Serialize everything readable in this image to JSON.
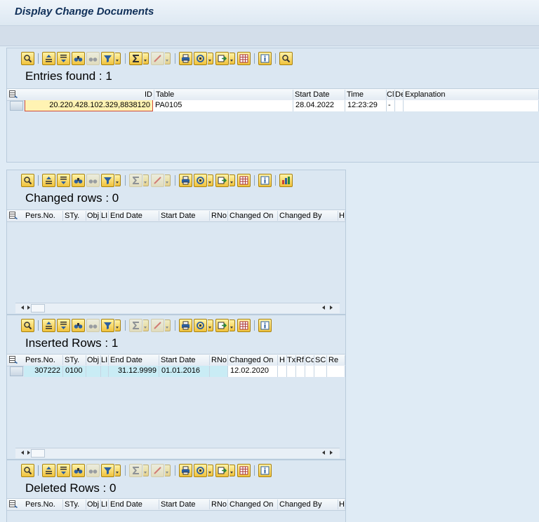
{
  "window": {
    "title": "Display Change Documents"
  },
  "toolbar_icons": [
    "details-icon",
    "sort-ascending-icon",
    "sort-descending-icon",
    "find-icon",
    "find-next-icon",
    "filter-icon",
    "total-icon",
    "subtotal-icon",
    "print-icon",
    "views-icon",
    "export-icon",
    "layout-icon",
    "info-icon",
    "graphic-icon"
  ],
  "entries": {
    "heading": "Entries found : 1",
    "columns": [
      "ID",
      "Table",
      "Start Date",
      "Time",
      "Cli",
      "De",
      "Explanation"
    ],
    "rows": [
      {
        "id": "20.220.428.102.329,8838120",
        "table": "PA0105",
        "start_date": "28.04.2022",
        "time": "12:23:29",
        "cli": "-",
        "de": "",
        "explanation": ""
      }
    ]
  },
  "changed": {
    "heading": "Changed rows : 0",
    "columns": [
      "Pers.No.",
      "STy.",
      "Obj",
      "LI",
      "End Date",
      "Start Date",
      "RNo",
      "Changed On",
      "Changed By",
      "H"
    ]
  },
  "inserted": {
    "heading": "Inserted Rows : 1",
    "columns": [
      "Pers.No.",
      "STy.",
      "Obj",
      "LI",
      "End Date",
      "Start Date",
      "RNo",
      "Changed On",
      "H",
      "Tx",
      "Rf",
      "Cc",
      "SC",
      "Re"
    ],
    "rows": [
      {
        "pers_no": "307222",
        "sty": "0100",
        "obj": "",
        "li": "",
        "end_date": "31.12.9999",
        "start_date": "01.01.2016",
        "rno": "",
        "changed_on": "12.02.2020"
      }
    ]
  },
  "deleted": {
    "heading": "Deleted Rows : 0",
    "columns": [
      "Pers.No.",
      "STy.",
      "Obj",
      "LI",
      "End Date",
      "Start Date",
      "RNo",
      "Changed On",
      "Changed By",
      "H"
    ]
  },
  "colors": {
    "accent": "#f0c23d",
    "selected_cell": "#fff3b3",
    "highlight_cell": "#c9ecf5",
    "background": "#dbe7f2"
  }
}
